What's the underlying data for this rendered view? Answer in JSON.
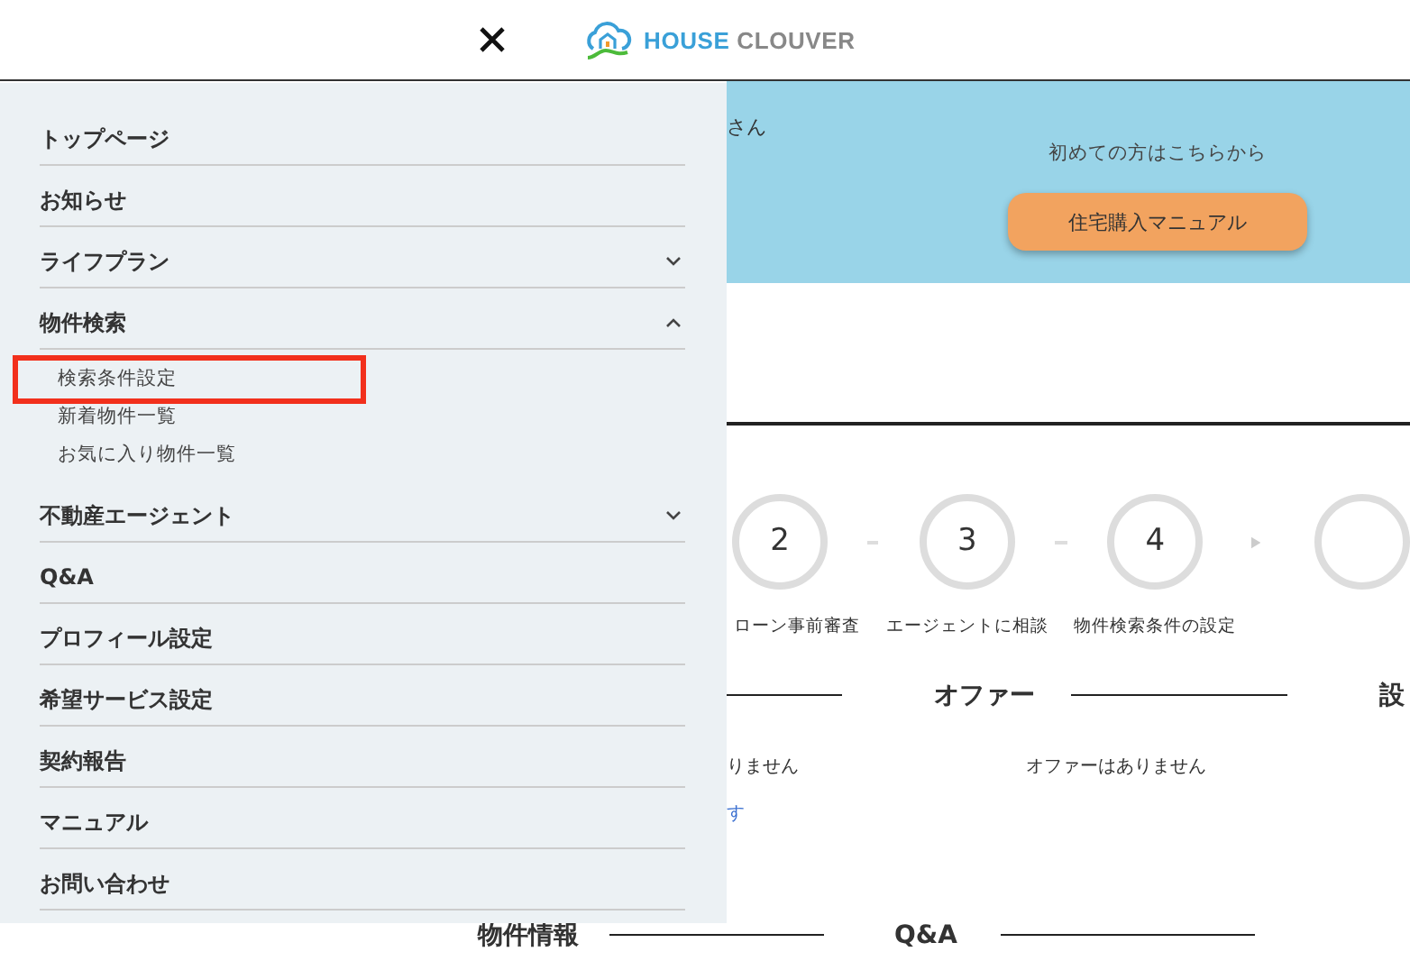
{
  "header": {
    "logo_words": [
      "HOUSE",
      "CLOUVER"
    ]
  },
  "banner": {
    "greeting": "さん",
    "intro": "初めての方はこちらから",
    "button": "住宅購入マニュアル"
  },
  "steps": [
    {
      "number": "2",
      "label": "ローン事前審査"
    },
    {
      "number": "3",
      "label": "エージェントに相談"
    },
    {
      "number": "4",
      "label": "物件検索条件の設定"
    }
  ],
  "sections": [
    {
      "title": "オファー",
      "empty_text": "オファーはありません"
    },
    {
      "title": "設"
    }
  ],
  "left_fragments": {
    "empty_text": "りません",
    "link": "す"
  },
  "bottom_sections": [
    {
      "title": "物件情報"
    },
    {
      "title": "Q&A"
    }
  ],
  "menu": [
    {
      "label": "トップページ",
      "kind": "link"
    },
    {
      "label": "お知らせ",
      "kind": "link"
    },
    {
      "label": "ライフプラン",
      "kind": "group",
      "expanded": false
    },
    {
      "label": "物件検索",
      "kind": "group",
      "expanded": true,
      "children": [
        {
          "label": "検索条件設定",
          "highlighted": true
        },
        {
          "label": "新着物件一覧",
          "highlighted": false
        },
        {
          "label": "お気に入り物件一覧",
          "highlighted": false
        }
      ]
    },
    {
      "label": "不動産エージェント",
      "kind": "group",
      "expanded": false
    },
    {
      "label": "Q&A",
      "kind": "link"
    },
    {
      "label": "プロフィール設定",
      "kind": "link"
    },
    {
      "label": "希望サービス設定",
      "kind": "link"
    },
    {
      "label": "契約報告",
      "kind": "link"
    },
    {
      "label": "マニュアル",
      "kind": "link"
    },
    {
      "label": "お問い合わせ",
      "kind": "link"
    }
  ]
}
